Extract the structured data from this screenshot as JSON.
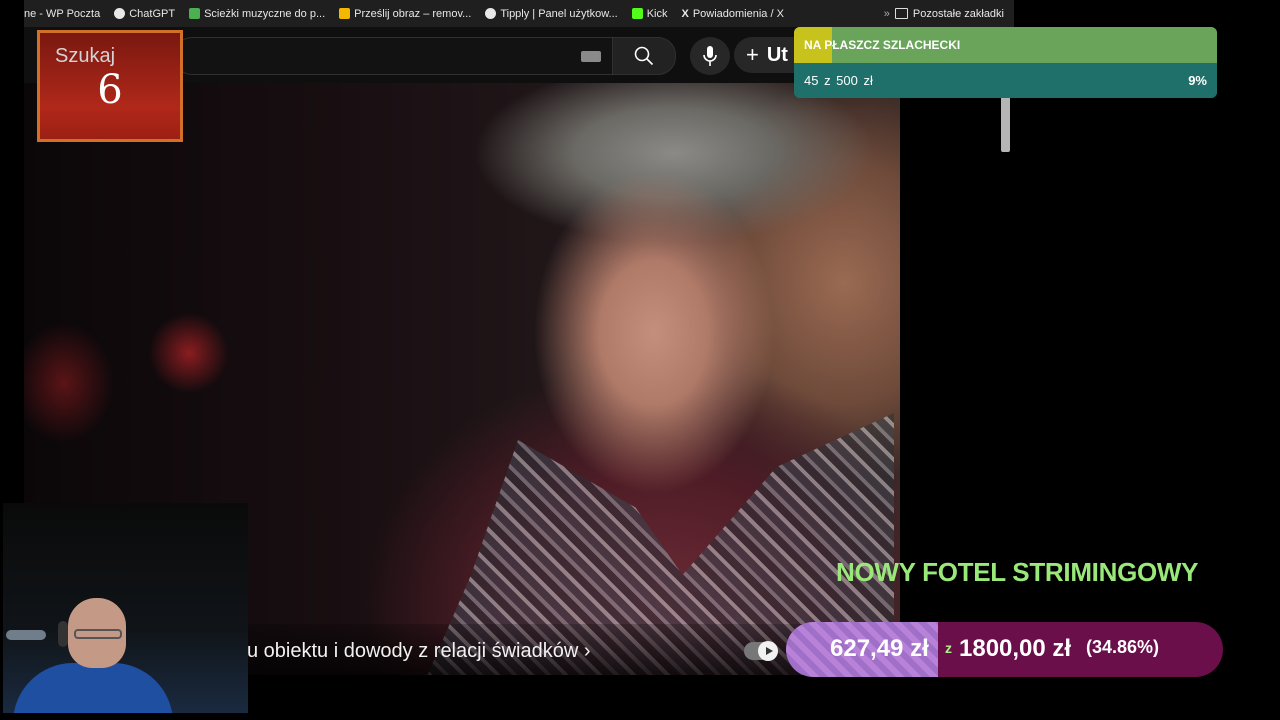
{
  "bookmarks": [
    {
      "label": "ne - WP Poczta",
      "icon": "wp-icon",
      "color": "#1f1f1f"
    },
    {
      "label": "ChatGPT",
      "icon": "chatgpt-icon",
      "color": "#e8e8e8"
    },
    {
      "label": "Scieżki muzyczne do p...",
      "icon": "music-icon",
      "color": "#4caf50"
    },
    {
      "label": "Prześlij obraz – remov...",
      "icon": "mail-icon",
      "color": "#f5b800"
    },
    {
      "label": "Tipply | Panel użytkow...",
      "icon": "tipply-icon",
      "color": "#e8e8e8"
    },
    {
      "label": "Kick",
      "icon": "kick-icon",
      "color": "#53fc18"
    },
    {
      "label": "Powiadomienia / X",
      "icon": "x-icon",
      "color": "#e8e8e8"
    }
  ],
  "bookmarks_more": "»",
  "bookmarks_folder": "Pozostałe zakładki",
  "header": {
    "create_label": "Ut",
    "avatar_color": "#7a9a8a"
  },
  "video": {
    "subtitle": "u obiektu i dowody z relacji świadków ›"
  },
  "search_widget": {
    "label": "Szukaj",
    "number": "6"
  },
  "goal": {
    "title": "NA PŁASZCZ SZLACHECKI",
    "amount": "45 z 500 zł",
    "percent_text": "9%",
    "fill_fraction": 0.09
  },
  "fotel": {
    "title": "NOWY FOTEL STRIMINGOWY",
    "current": "627,49 zł",
    "separator": "z",
    "target": "1800,00 zł",
    "percent_text": "(34.86%)",
    "fill_fraction": 0.3486
  },
  "colors": {
    "accent_green": "#9be87a",
    "goal_teal": "#1f6f6a",
    "fotel_purple": "#6a0f4a"
  }
}
